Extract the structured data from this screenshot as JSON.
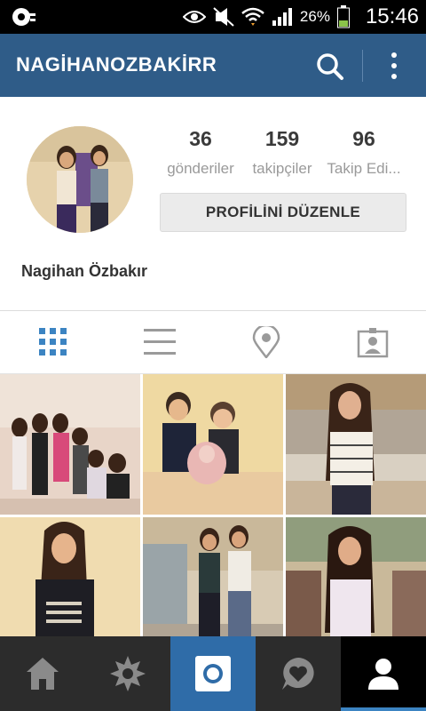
{
  "status_bar": {
    "battery_percent": "26%",
    "time": "15:46",
    "icons": [
      "notification-icon",
      "eye-icon",
      "mute-icon",
      "wifi-icon",
      "signal-icon",
      "battery-icon"
    ]
  },
  "app_bar": {
    "username": "NAGİHANOZBAKİRR",
    "icons": [
      "search-icon",
      "more-vertical-icon"
    ]
  },
  "profile": {
    "stats": [
      {
        "value": "36",
        "label": "gönderiler"
      },
      {
        "value": "159",
        "label": "takipçiler"
      },
      {
        "value": "96",
        "label": "Takip Edi..."
      }
    ],
    "edit_button": "PROFİLİNİ DÜZENLE",
    "full_name": "Nagihan Özbakır"
  },
  "view_tabs": [
    {
      "icon": "grid-icon",
      "active": true
    },
    {
      "icon": "list-icon",
      "active": false
    },
    {
      "icon": "location-pin-icon",
      "active": false
    },
    {
      "icon": "tagged-person-icon",
      "active": false
    }
  ],
  "photos": [
    {
      "icon": "photo-thumbnail"
    },
    {
      "icon": "photo-thumbnail"
    },
    {
      "icon": "photo-thumbnail"
    },
    {
      "icon": "photo-thumbnail"
    },
    {
      "icon": "photo-thumbnail"
    },
    {
      "icon": "photo-thumbnail"
    }
  ],
  "bottom_nav": [
    {
      "icon": "home-icon",
      "active": false
    },
    {
      "icon": "explore-icon",
      "active": false
    },
    {
      "icon": "camera-icon",
      "active": false
    },
    {
      "icon": "activity-heart-icon",
      "active": false
    },
    {
      "icon": "profile-icon",
      "active": true
    }
  ],
  "colors": {
    "app_bar": "#2f5c88",
    "accent_blue": "#3c84c2",
    "bottom_nav": "#2c2c2c",
    "camera_tab": "#2f6ca8",
    "active_profile_tab": "#000000",
    "active_indicator": "#3c84c2"
  }
}
